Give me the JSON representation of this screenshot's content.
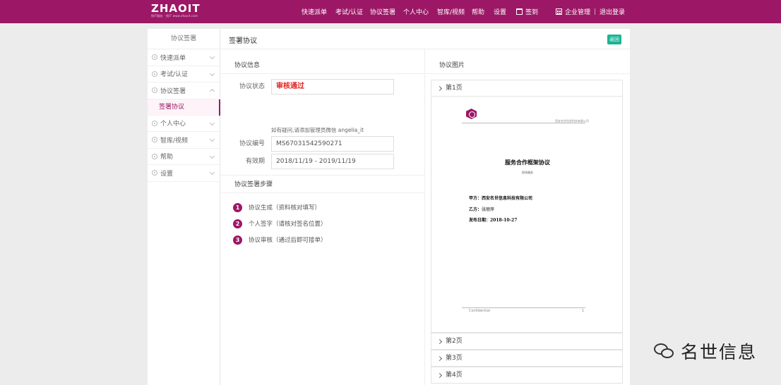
{
  "logo": {
    "name": "ZHAOIT",
    "tagline": "找IT服务 · 找IT   www.zhaoit.com"
  },
  "topnav": {
    "items": [
      "快速派单",
      "考试/认证",
      "协议签署",
      "个人中心",
      "智库/视频",
      "帮助",
      "设置"
    ],
    "sign_in": "签到",
    "enterprise": "企业管理",
    "separator": "|",
    "logout": "退出登录"
  },
  "sidebar": {
    "title": "协议签署",
    "items": [
      {
        "label": "快速派单"
      },
      {
        "label": "考试/认证"
      },
      {
        "label": "协议签署"
      },
      {
        "label": "个人中心"
      },
      {
        "label": "智库/视频"
      },
      {
        "label": "帮助"
      },
      {
        "label": "设置"
      }
    ],
    "active_sub": "签署协议"
  },
  "main": {
    "title": "签署协议",
    "back_label": "返回",
    "info": {
      "heading": "协议信息",
      "status_label": "协议状态",
      "status_value": "审核通过",
      "hint": "如有疑问,请添加管理员微信 angelia_it",
      "number_label": "协议编号",
      "number_value": "MS67031542590271",
      "validity_label": "有效期",
      "validity_value": "2018/11/19 - 2019/11/19"
    },
    "steps": {
      "heading": "协议签署步骤",
      "items": [
        {
          "num": "1",
          "text": "协议生成（资料核对填写）"
        },
        {
          "num": "2",
          "text": "个人签字（请核对签名位置）"
        },
        {
          "num": "3",
          "text": "协议审核（通过后即可接单）"
        }
      ]
    },
    "pictures": {
      "heading": "协议图片",
      "pages": [
        "第1页",
        "第2页",
        "第3页",
        "第4页"
      ],
      "doc": {
        "company_header": "西安名世信息科技有限公司",
        "title": "服务合作框架协议",
        "subtitle": "现场服务",
        "party_a_label": "甲方：",
        "party_a_value": "西安名世信息科技有限公司",
        "party_b_label": "乙方：",
        "party_b_value": "张丽萍",
        "date_label": "发布日期：",
        "date_value": "2018-10-27",
        "footer_left": "Confidential",
        "footer_right": "1"
      }
    }
  },
  "watermark": {
    "text": "名世信息"
  }
}
